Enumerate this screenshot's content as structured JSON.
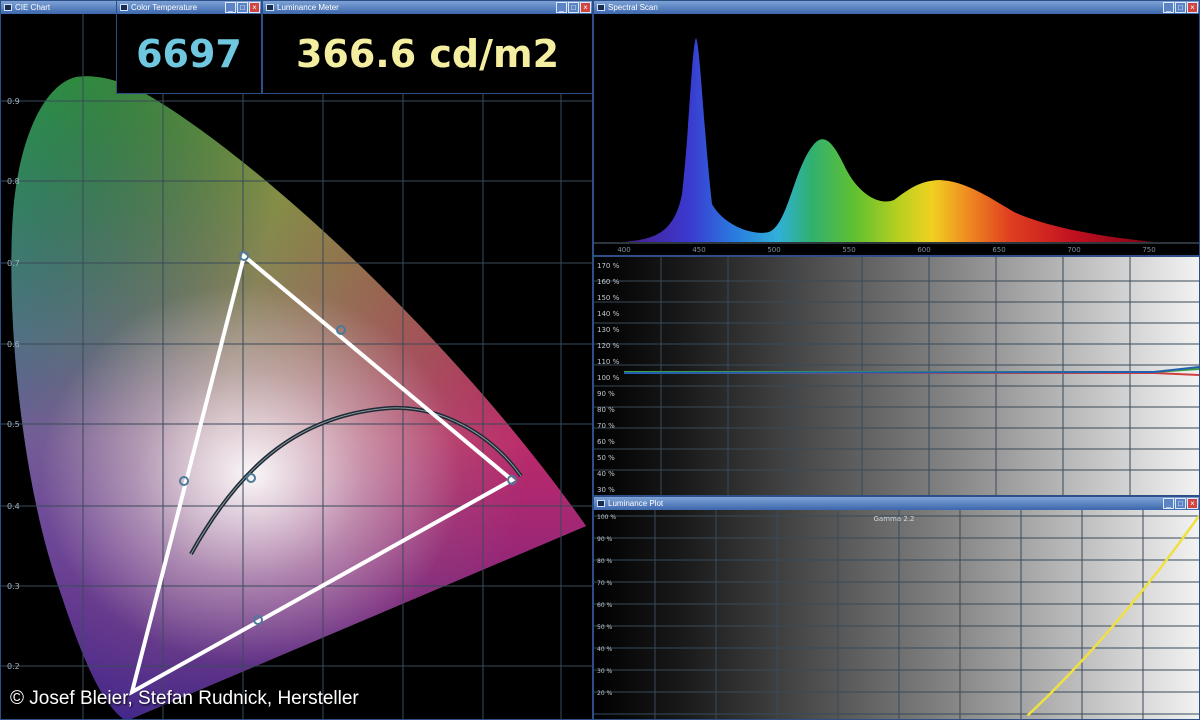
{
  "colors": {
    "window_border": "#2b4f86",
    "titlebar": "#3c67ad",
    "cct_value": "#6fc8e0",
    "luminance_value": "#f4efa0",
    "gamut": "#ffffff",
    "curve": "#1f2a33",
    "gamma_curve": "#f0e040"
  },
  "windows": {
    "cie": {
      "title": "CIE Chart",
      "y_labels": [
        "0.9",
        "0.8",
        "0.7",
        "0.6",
        "0.5",
        "0.4",
        "0.3",
        "0.2",
        "0.1"
      ]
    },
    "cct": {
      "title": "Color Temperature",
      "value": "6697"
    },
    "luminance": {
      "title": "Luminance Meter",
      "value": "366.6 cd/m2"
    },
    "spectral": {
      "title": "Spectral Scan",
      "x_labels": [
        "400",
        "450",
        "500",
        "550",
        "600",
        "650",
        "700",
        "750"
      ]
    },
    "rgb_balance": {
      "y_labels": [
        "170 %",
        "160 %",
        "150 %",
        "140 %",
        "130 %",
        "120 %",
        "110 %",
        "100 %",
        "90 %",
        "80 %",
        "70 %",
        "60 %",
        "50 %",
        "40 %",
        "30 %"
      ]
    },
    "lum_plot": {
      "title": "Luminance Plot",
      "subtitle": "Gamma 2.2",
      "y_labels": [
        "100 %",
        "90 %",
        "80 %",
        "70 %",
        "60 %",
        "50 %",
        "40 %",
        "30 %",
        "20 %"
      ]
    }
  },
  "gamma_curve": {
    "exponent": 2.2
  },
  "window_buttons": {
    "minimize": "_",
    "maximize": "□",
    "close": "×"
  },
  "copyright": "© Josef Bleier, Stefan Rudnick, Hersteller"
}
